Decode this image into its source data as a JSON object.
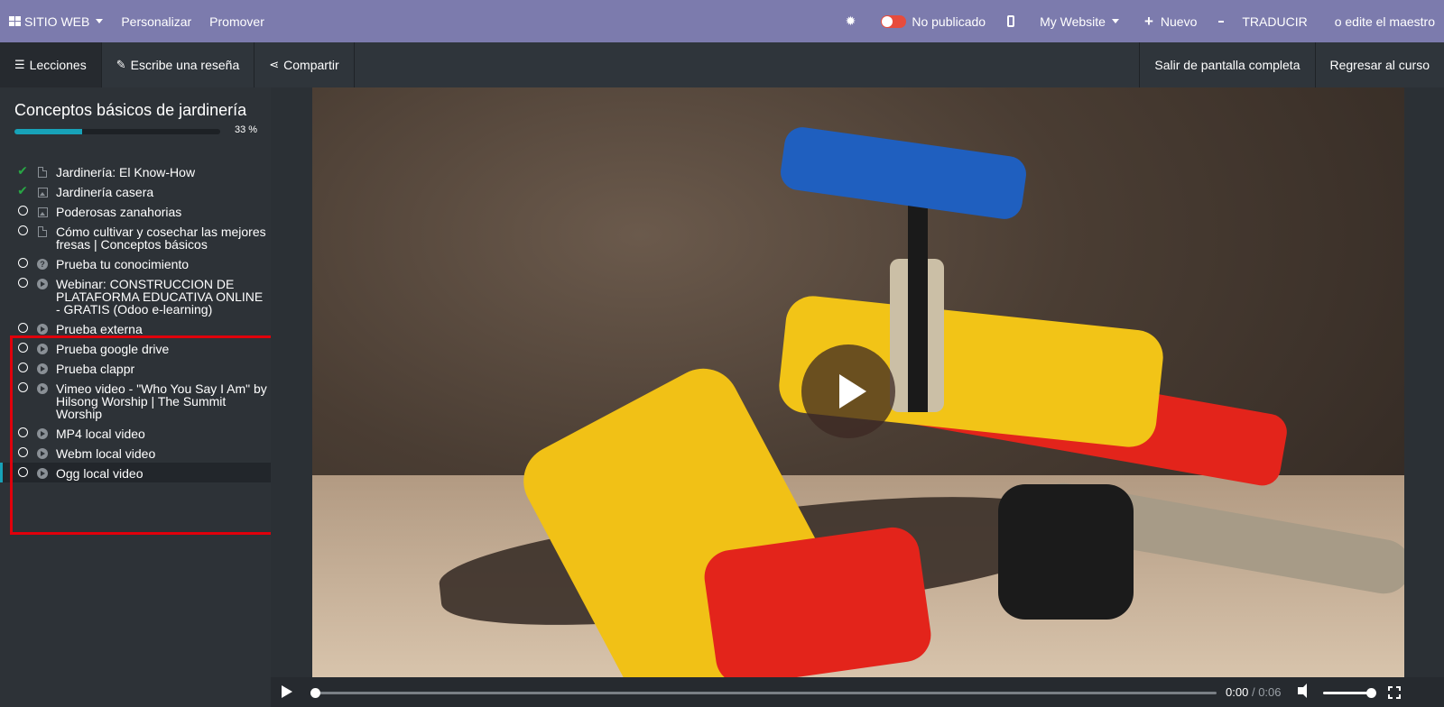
{
  "topbar": {
    "site_label": "SITIO WEB",
    "personalize": "Personalizar",
    "promote": "Promover",
    "publish_status": "No publicado",
    "website_name": "My Website",
    "new_label": "Nuevo",
    "translate": "TRADUCIR",
    "edit_master": "o edite el maestro"
  },
  "subbar": {
    "lessons_tab": "Lecciones",
    "review_tab": "Escribe una reseña",
    "share_tab": "Compartir",
    "exit_fullscreen": "Salir de pantalla completa",
    "back_to_course": "Regresar al curso"
  },
  "course": {
    "title": "Conceptos básicos de jardinería",
    "progress_text": "33 %",
    "progress_fraction": 0.33
  },
  "lessons": [
    {
      "label": "Jardinería: El Know-How",
      "status": "done",
      "type": "document"
    },
    {
      "label": "Jardinería casera",
      "status": "done",
      "type": "image"
    },
    {
      "label": "Poderosas zanahorias",
      "status": "todo",
      "type": "image"
    },
    {
      "label": "Cómo cultivar y cosechar las mejores fresas | Conceptos básicos",
      "status": "todo",
      "type": "document"
    },
    {
      "label": "Prueba tu conocimiento",
      "status": "todo",
      "type": "quiz"
    },
    {
      "label": "Webinar: CONSTRUCCION DE PLATAFORMA EDUCATIVA ONLINE - GRATIS (Odoo e-learning)",
      "status": "todo",
      "type": "video"
    },
    {
      "label": "Prueba externa",
      "status": "todo",
      "type": "video"
    },
    {
      "label": "Prueba google drive",
      "status": "todo",
      "type": "video"
    },
    {
      "label": "Prueba clappr",
      "status": "todo",
      "type": "video"
    },
    {
      "label": "Vimeo video - \"Who You Say I Am\" by Hilsong Worship | The Summit Worship",
      "status": "todo",
      "type": "video"
    },
    {
      "label": "MP4 local video",
      "status": "todo",
      "type": "video"
    },
    {
      "label": "Webm local video",
      "status": "todo",
      "type": "video"
    },
    {
      "label": "Ogg local video",
      "status": "todo",
      "type": "video",
      "current": true
    }
  ],
  "player": {
    "current_time": "0:00",
    "separator": "/",
    "duration": "0:06",
    "playback_fraction": 0,
    "volume_fraction": 1
  }
}
